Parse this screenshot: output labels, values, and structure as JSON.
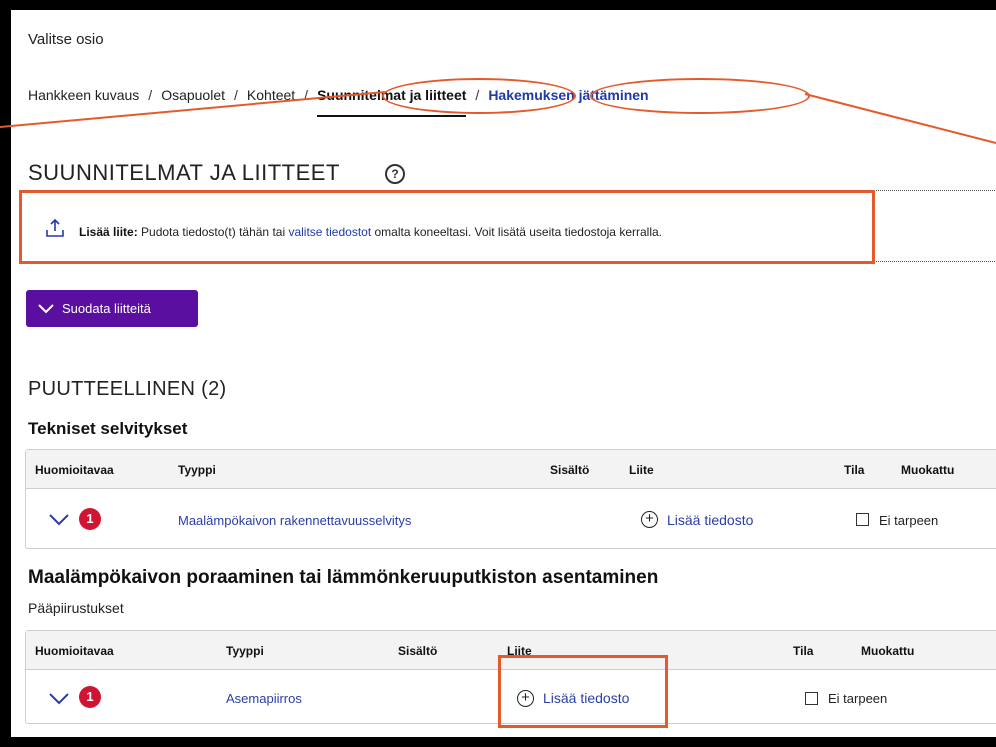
{
  "section_select_label": "Valitse osio",
  "breadcrumb": {
    "items": [
      "Hankkeen kuvaus",
      "Osapuolet",
      "Kohteet",
      "Suunnitelmat ja liitteet",
      "Hakemuksen jättäminen"
    ],
    "separator": "/",
    "active_index": 3
  },
  "page_title": "SUUNNITELMAT JA LIITTEET",
  "help_icon": "?",
  "dropzone": {
    "bold": "Lisää liite:",
    "text_before": " Pudota tiedosto(t) tähän tai ",
    "link": "valitse tiedostot",
    "text_after": " omalta koneeltasi. Voit lisätä useita tiedostoja kerralla."
  },
  "filter_button": "Suodata liitteitä",
  "group_title": "PUUTTEELLINEN (2)",
  "sections": [
    {
      "title": "Tekniset selvitykset",
      "columns": [
        "Huomioitavaa",
        "Tyyppi",
        "Sisältö",
        "Liite",
        "Tila",
        "Muokattu"
      ],
      "rows": [
        {
          "badge": "1",
          "type": "Maalämpökaivon rakennettavuusselvitys",
          "attach": "Lisää tiedosto",
          "status": "Ei tarpeen"
        }
      ]
    },
    {
      "title": "Maalämpökaivon poraaminen tai lämmönkeruuputkiston asentaminen",
      "caption": "Pääpiirustukset",
      "columns": [
        "Huomioitavaa",
        "Tyyppi",
        "Sisältö",
        "Liite",
        "Tila",
        "Muokattu"
      ],
      "rows": [
        {
          "badge": "1",
          "type": "Asemapiirros",
          "attach": "Lisää tiedosto",
          "status": "Ei tarpeen"
        }
      ]
    }
  ],
  "colors": {
    "accent": "#5b0fa0",
    "link": "#1f3aa6",
    "badge": "#d11431",
    "annotation": "#e35a2c"
  }
}
